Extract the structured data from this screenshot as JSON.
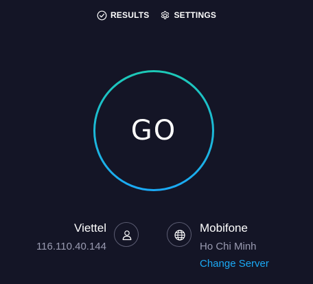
{
  "nav": {
    "results_label": "RESULTS",
    "results_icon": "check-circle-icon",
    "settings_label": "SETTINGS",
    "settings_icon": "gear-icon"
  },
  "go_button": {
    "label": "GO",
    "ring_color_start": "#1dc9b7",
    "ring_color_end": "#1ba9f5"
  },
  "isp": {
    "name": "Viettel",
    "ip": "116.110.40.144",
    "icon": "user-icon"
  },
  "server": {
    "name": "Mobifone",
    "location": "Ho Chi Minh",
    "change_label": "Change Server",
    "icon": "globe-icon"
  },
  "colors": {
    "background": "#141526",
    "secondary_text": "#9a9bb1",
    "link": "#1ba9f5"
  }
}
